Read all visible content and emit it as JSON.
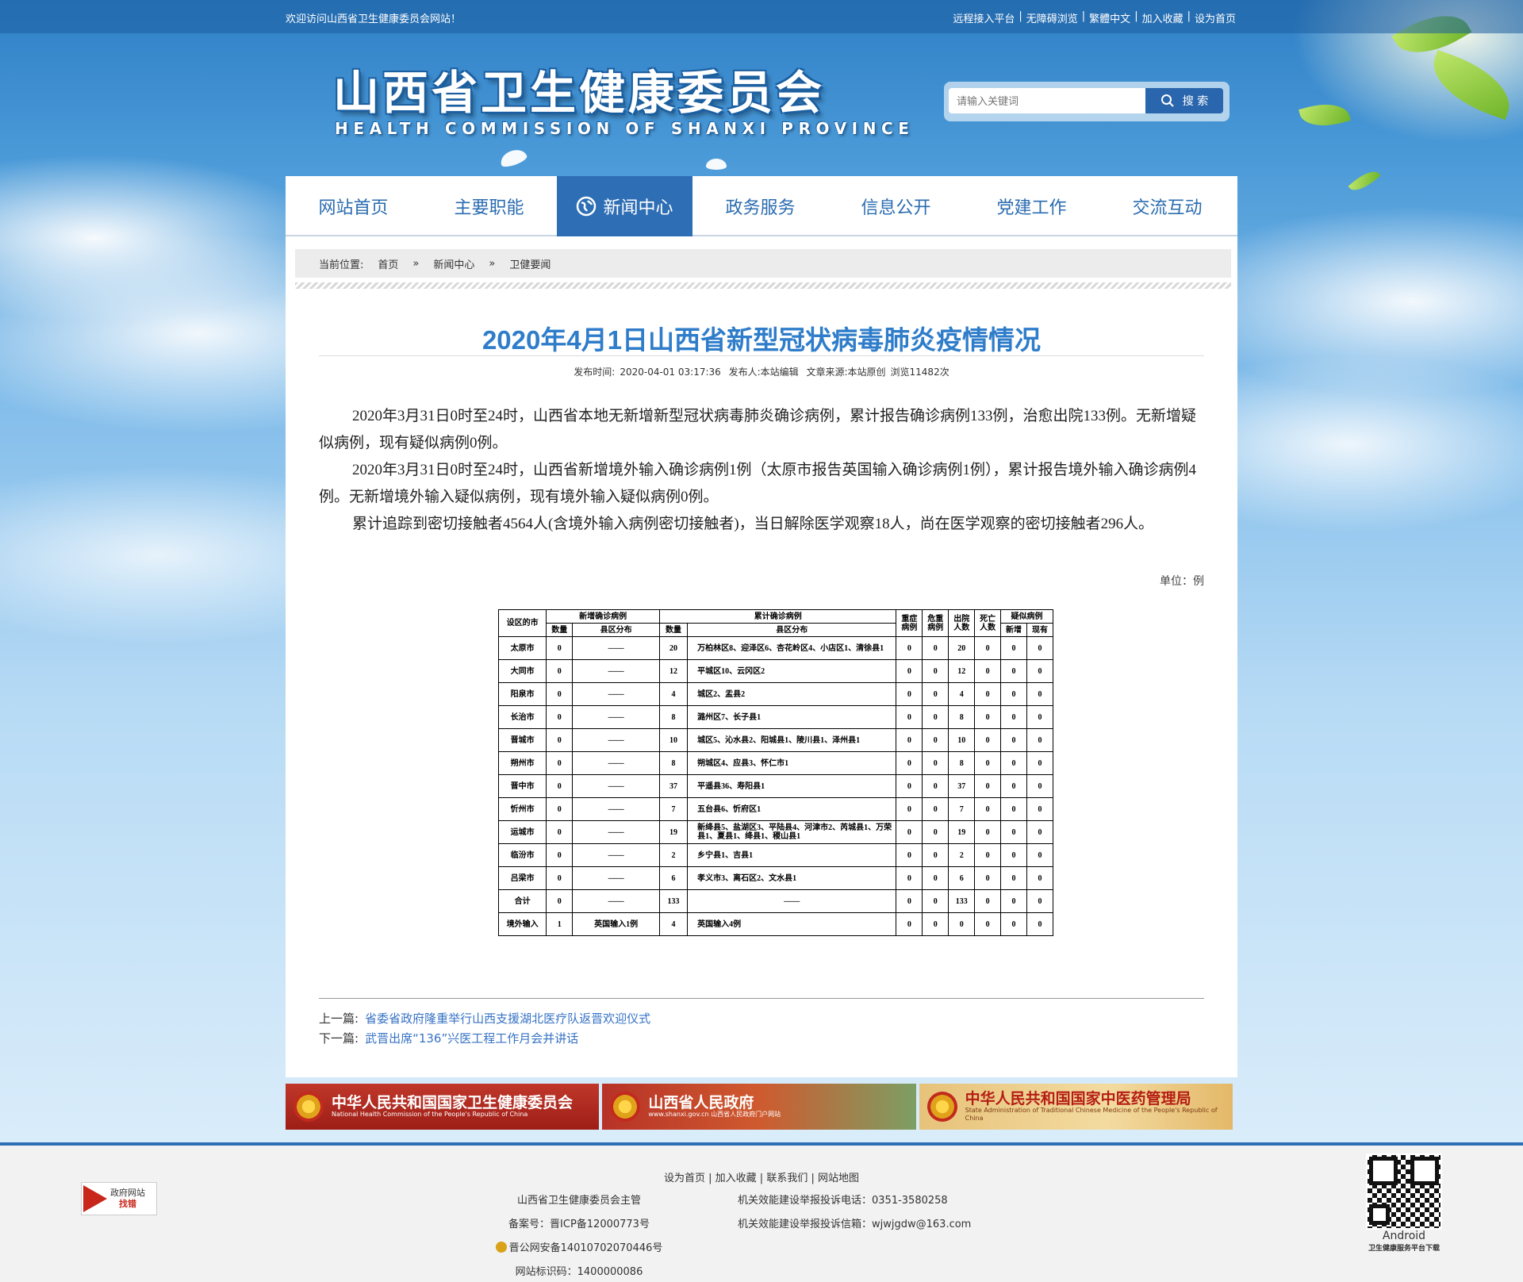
{
  "topbar": {
    "welcome": "欢迎访问山西省卫生健康委员会网站！",
    "links": [
      "远程接入平台",
      "无障碍浏览",
      "繁體中文",
      "加入收藏",
      "设为首页"
    ],
    "sep": "|"
  },
  "header": {
    "logo_cn": "山西省卫生健康委员会",
    "logo_en": "HEALTH COMMISSION OF SHANXI PROVINCE"
  },
  "search": {
    "placeholder": "请输入关键词",
    "button": "搜 索"
  },
  "nav": {
    "items": [
      "网站首页",
      "主要职能",
      "新闻中心",
      "政务服务",
      "信息公开",
      "党建工作",
      "交流互动"
    ],
    "active_index": 2
  },
  "breadcrumb": {
    "label": "当前位置:",
    "items": [
      "首页",
      "新闻中心",
      "卫健要闻"
    ],
    "sep": "»"
  },
  "article": {
    "title": "2020年4月1日山西省新型冠状病毒肺炎疫情情况",
    "meta": {
      "published": "发布时间:",
      "date": "2020-04-01 03:17:36",
      "publisher": "发布人:本站编辑",
      "source": "文章来源:本站原创",
      "views": "浏览11482次"
    },
    "paragraphs": [
      "2020年3月31日0时至24时，山西省本地无新增新型冠状病毒肺炎确诊病例，累计报告确诊病例133例，治愈出院133例。无新增疑似病例，现有疑似病例0例。",
      "2020年3月31日0时至24时，山西省新增境外输入确诊病例1例（太原市报告英国输入确诊病例1例），累计报告境外输入确诊病例4例。无新增境外输入疑似病例，现有境外输入疑似病例0例。",
      "累计追踪到密切接触者4564人(含境外输入病例密切接触者)，当日解除医学观察18人，尚在医学观察的密切接触者296人。"
    ],
    "unit": "单位：例"
  },
  "table": {
    "headers": {
      "city": "设区的市",
      "new_group": "新增确诊病例",
      "cum_group": "累计确诊病例",
      "severe": "重症病例",
      "critical": "危重病例",
      "discharged": "出院人数",
      "death": "死亡人数",
      "suspect_group": "疑似病例",
      "count": "数量",
      "district": "县区分布",
      "new": "新增",
      "current": "现有"
    },
    "rows": [
      [
        "太原市",
        "0",
        "——",
        "20",
        "万柏林区8、迎泽区6、杏花岭区4、小店区1、清徐县1",
        "0",
        "0",
        "20",
        "0",
        "0",
        "0"
      ],
      [
        "大同市",
        "0",
        "——",
        "12",
        "平城区10、云冈区2",
        "0",
        "0",
        "12",
        "0",
        "0",
        "0"
      ],
      [
        "阳泉市",
        "0",
        "——",
        "4",
        "城区2、盂县2",
        "0",
        "0",
        "4",
        "0",
        "0",
        "0"
      ],
      [
        "长治市",
        "0",
        "——",
        "8",
        "潞州区7、长子县1",
        "0",
        "0",
        "8",
        "0",
        "0",
        "0"
      ],
      [
        "晋城市",
        "0",
        "——",
        "10",
        "城区5、沁水县2、阳城县1、陵川县1、泽州县1",
        "0",
        "0",
        "10",
        "0",
        "0",
        "0"
      ],
      [
        "朔州市",
        "0",
        "——",
        "8",
        "朔城区4、应县3、怀仁市1",
        "0",
        "0",
        "8",
        "0",
        "0",
        "0"
      ],
      [
        "晋中市",
        "0",
        "——",
        "37",
        "平遥县36、寿阳县1",
        "0",
        "0",
        "37",
        "0",
        "0",
        "0"
      ],
      [
        "忻州市",
        "0",
        "——",
        "7",
        "五台县6、忻府区1",
        "0",
        "0",
        "7",
        "0",
        "0",
        "0"
      ],
      [
        "运城市",
        "0",
        "——",
        "19",
        "新绛县5、盐湖区3、平陆县4、河津市2、芮城县1、万荣县1、夏县1、绛县1、稷山县1",
        "0",
        "0",
        "19",
        "0",
        "0",
        "0"
      ],
      [
        "临汾市",
        "0",
        "——",
        "2",
        "乡宁县1、吉县1",
        "0",
        "0",
        "2",
        "0",
        "0",
        "0"
      ],
      [
        "吕梁市",
        "0",
        "——",
        "6",
        "孝义市3、离石区2、文水县1",
        "0",
        "0",
        "6",
        "0",
        "0",
        "0"
      ],
      [
        "合计",
        "0",
        "——",
        "133",
        "——",
        "0",
        "0",
        "133",
        "0",
        "0",
        "0"
      ],
      [
        "境外输入",
        "1",
        "英国输入1例",
        "4",
        "英国输入4例",
        "0",
        "0",
        "0",
        "0",
        "0",
        "0"
      ]
    ]
  },
  "prevnext": {
    "prev_label": "上一篇:",
    "prev": "省委省政府隆重举行山西支援湖北医疗队返晋欢迎仪式",
    "next_label": "下一篇:",
    "next": "武晋出席“136”兴医工程工作月会并讲话"
  },
  "banners": [
    {
      "title": "中华人民共和国国家卫生健康委员会",
      "sub": "National Health Commission of the People's Republic of China"
    },
    {
      "title": "山西省人民政府",
      "sub": "www.shanxi.gov.cn 山西省人民政府门户网站"
    },
    {
      "title": "中华人民共和国国家中医药管理局",
      "sub": "State Administration of Traditional Chinese Medicine of the People's Republic of China"
    }
  ],
  "footer": {
    "links": [
      "设为首页",
      "加入收藏",
      "联系我们",
      "网站地图"
    ],
    "sponsor": "山西省卫生健康委员会主管",
    "icp": "备案号：晋ICP备12000773号",
    "police": "晋公网安备14010702070446号",
    "site_id": "网站标识码：1400000086",
    "phone": "机关效能建设举报投诉电话：0351-3580258",
    "email": "机关效能建设举报投诉信箱：wjwjgdw@163.com",
    "gov_badge_line1": "政府网站",
    "gov_badge_line2": "找错",
    "qr_label": "Android",
    "qr_sub": "卫生健康服务平台下载"
  }
}
